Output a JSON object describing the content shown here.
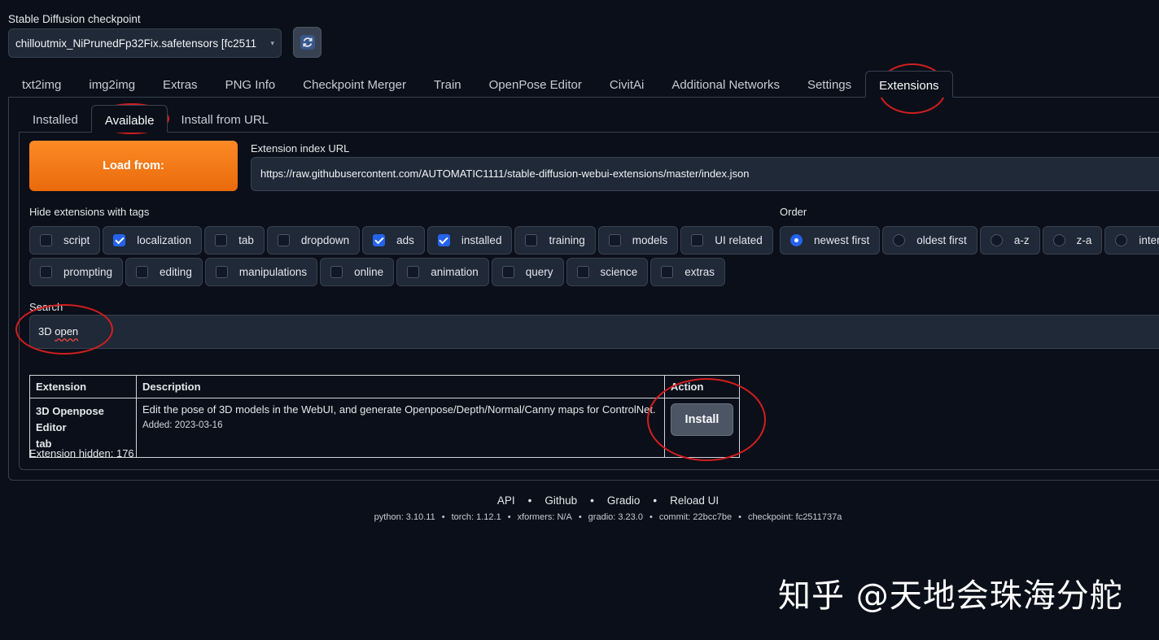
{
  "checkpoint": {
    "label": "Stable Diffusion checkpoint",
    "value": "chilloutmix_NiPrunedFp32Fix.safetensors [fc2511"
  },
  "main_tabs": [
    "txt2img",
    "img2img",
    "Extras",
    "PNG Info",
    "Checkpoint Merger",
    "Train",
    "OpenPose Editor",
    "CivitAi",
    "Additional Networks",
    "Settings",
    "Extensions"
  ],
  "main_tab_active": "Extensions",
  "sub_tabs": [
    "Installed",
    "Available",
    "Install from URL"
  ],
  "sub_tab_active": "Available",
  "load_button": "Load from:",
  "index_url": {
    "label": "Extension index URL",
    "value": "https://raw.githubusercontent.com/AUTOMATIC1111/stable-diffusion-webui-extensions/master/index.json"
  },
  "hide_tags": {
    "label": "Hide extensions with tags",
    "row1": [
      {
        "label": "script",
        "checked": false
      },
      {
        "label": "localization",
        "checked": true
      },
      {
        "label": "tab",
        "checked": false
      },
      {
        "label": "dropdown",
        "checked": false
      },
      {
        "label": "ads",
        "checked": true
      },
      {
        "label": "installed",
        "checked": true
      },
      {
        "label": "training",
        "checked": false
      },
      {
        "label": "models",
        "checked": false
      },
      {
        "label": "UI related",
        "checked": false
      }
    ],
    "row2": [
      {
        "label": "prompting",
        "checked": false
      },
      {
        "label": "editing",
        "checked": false
      },
      {
        "label": "manipulations",
        "checked": false
      },
      {
        "label": "online",
        "checked": false
      },
      {
        "label": "animation",
        "checked": false
      },
      {
        "label": "query",
        "checked": false
      },
      {
        "label": "science",
        "checked": false
      },
      {
        "label": "extras",
        "checked": false
      }
    ]
  },
  "order": {
    "label": "Order",
    "options": [
      {
        "label": "newest first",
        "selected": true
      },
      {
        "label": "oldest first",
        "selected": false
      },
      {
        "label": "a-z",
        "selected": false
      },
      {
        "label": "z-a",
        "selected": false
      },
      {
        "label": "internal or",
        "selected": false
      }
    ]
  },
  "search": {
    "label": "Search",
    "value_a": "3D ",
    "value_b": "open"
  },
  "table": {
    "headers": {
      "extension": "Extension",
      "description": "Description",
      "action": "Action"
    },
    "rows": [
      {
        "name_line1": "3D Openpose Editor",
        "name_line2": "tab",
        "description": "Edit the pose of 3D models in the WebUI, and generate Openpose/Depth/Normal/Canny maps for ControlNet.",
        "added": "Added: 2023-03-16",
        "action": "Install"
      }
    ]
  },
  "hidden_count": "Extension hidden: 176",
  "footer": {
    "links": [
      "API",
      "Github",
      "Gradio",
      "Reload UI"
    ],
    "info": [
      "python: 3.10.11",
      "torch: 1.12.1",
      "xformers: N/A",
      "gradio: 3.23.0",
      "commit: 22bcc7be",
      "checkpoint: fc2511737a"
    ]
  },
  "watermark": "知乎 @天地会珠海分舵",
  "colors": {
    "accent_orange": "#f97316",
    "annotation_red": "#d21f1f",
    "checkbox_blue": "#2563eb",
    "background": "#0b0f19"
  },
  "icons": {
    "refresh": "refresh-icon",
    "dropdown": "chevron-down-icon"
  }
}
